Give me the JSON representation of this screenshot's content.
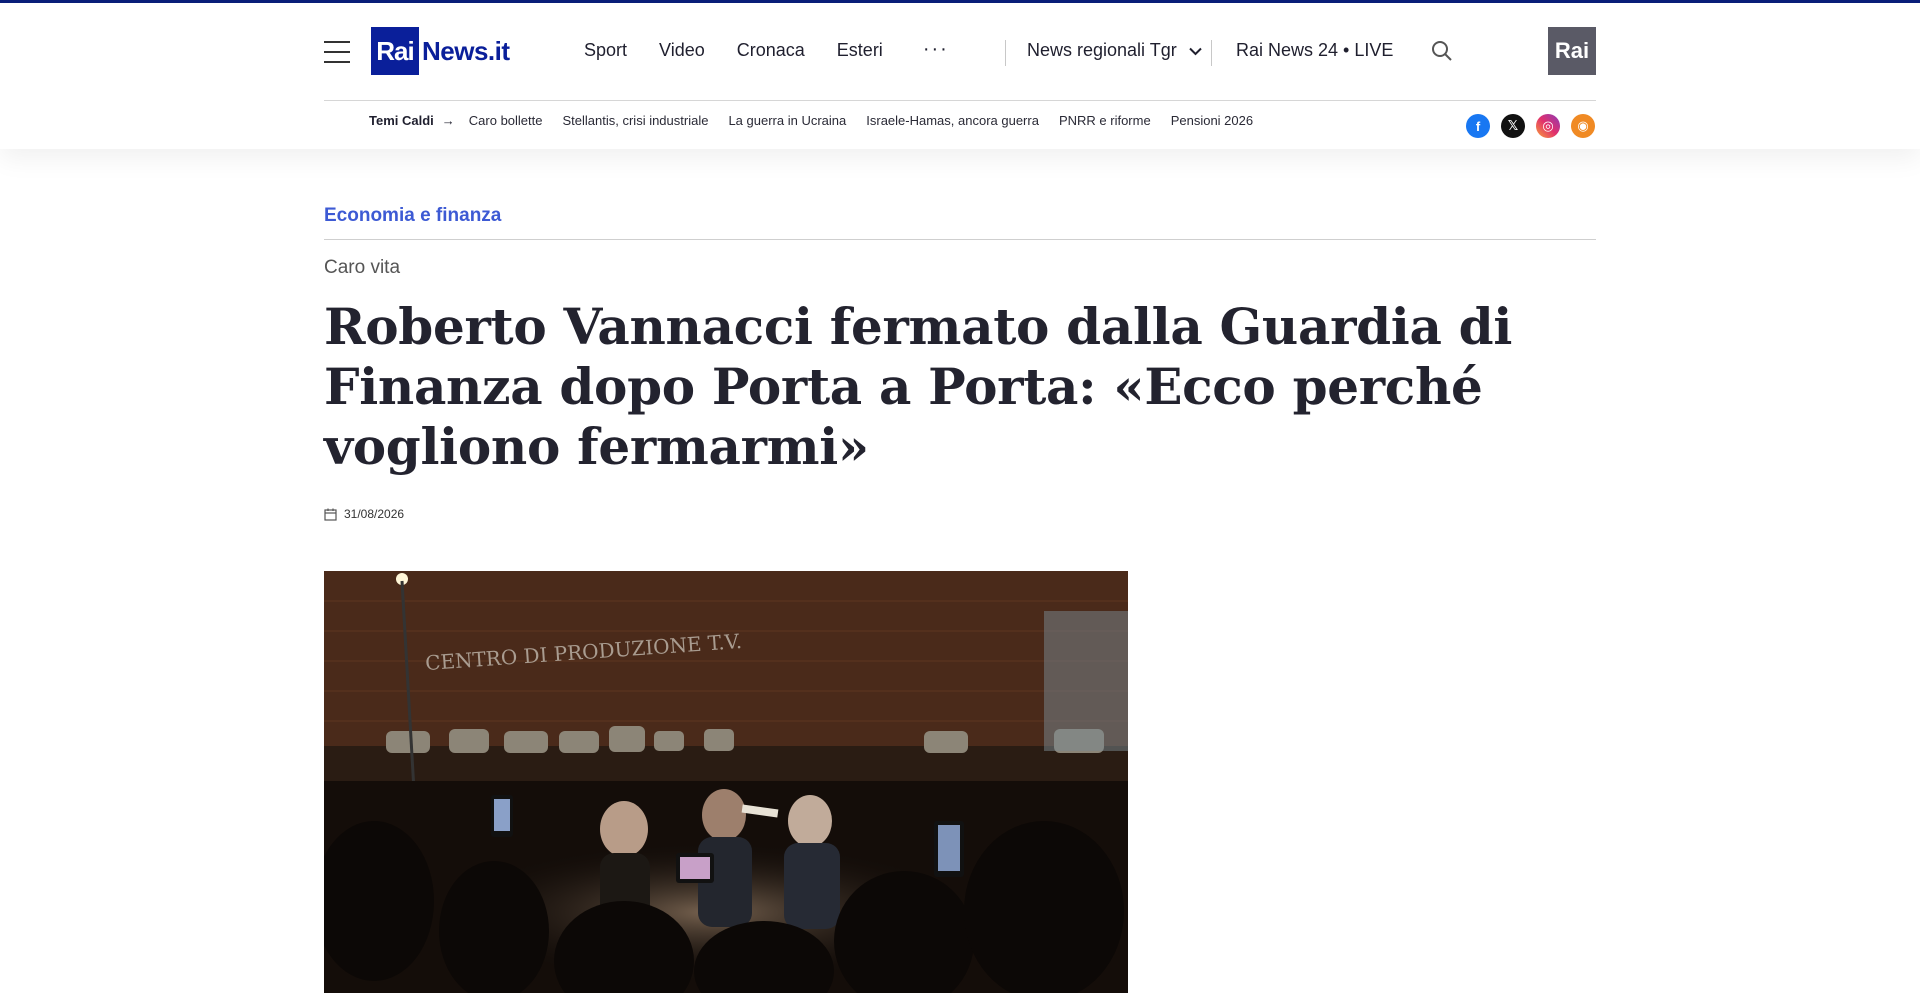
{
  "header": {
    "logo_mark": "Rai",
    "logo_text": "News.it",
    "nav": [
      "Sport",
      "Video",
      "Cronaca",
      "Esteri"
    ],
    "more_label": "···",
    "regionali_label": "News regionali Tgr",
    "live_label": "Rai News 24 • LIVE",
    "rai_logo": "Rai",
    "brand_color": "#0a1f9a"
  },
  "temi": {
    "title": "Temi Caldi",
    "arrow": "→",
    "items": [
      "Caro bollette",
      "Stellantis, crisi industriale",
      "La guerra in Ucraina",
      "Israele-Hamas, ancora guerra",
      "PNRR e riforme",
      "Pensioni 2026"
    ]
  },
  "social": {
    "icons": [
      "facebook-icon",
      "x-icon",
      "instagram-icon",
      "rss-icon"
    ],
    "labels": [
      "f",
      "𝕏",
      "◎",
      "◉"
    ]
  },
  "article": {
    "category": "Economia e finanza",
    "kicker": "Caro vita",
    "headline": "Roberto Vannacci fermato dalla Guardia di Finanza dopo Porta a Porta: «Ecco perché vogliono fermarmi»",
    "date": "31/08/2026",
    "photo_sign": "CENTRO DI PRODUZIONE T.V.",
    "accent_color": "#3d5ad4"
  }
}
